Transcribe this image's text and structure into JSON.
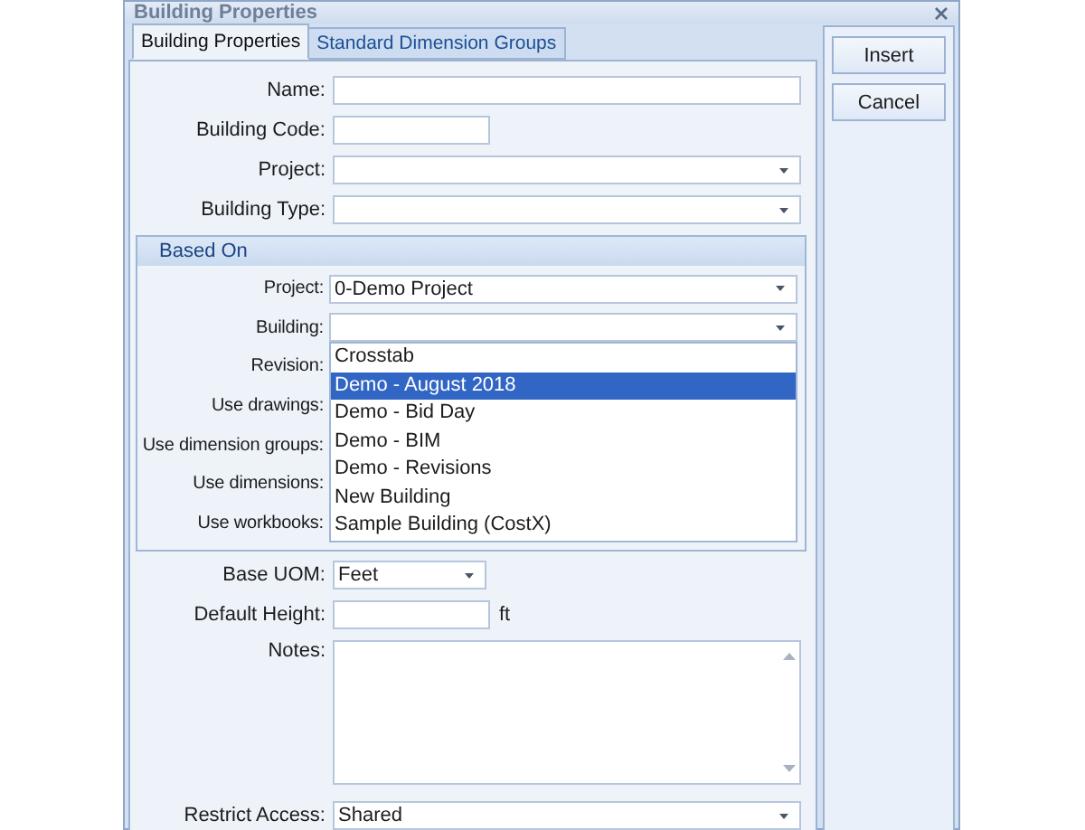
{
  "window": {
    "title": "Building Properties"
  },
  "tabs": [
    {
      "label": "Building Properties",
      "selected": true
    },
    {
      "label": "Standard Dimension Groups",
      "selected": false
    }
  ],
  "fields": [
    {
      "label": "Name:",
      "kind": "text"
    },
    {
      "label": "Building Code:",
      "kind": "short-text"
    },
    {
      "label": "Project:",
      "kind": "combo"
    },
    {
      "label": "Building Type:",
      "kind": "combo"
    }
  ],
  "based_on": {
    "title": "Based On",
    "fields": [
      {
        "label": "Project:",
        "kind": "combo",
        "value": "0-Demo Project"
      },
      {
        "label": "Building:",
        "kind": "combo",
        "expanded": true,
        "options": [
          {
            "label": "Crosstab",
            "selected": false
          },
          {
            "label": "Demo - August 2018",
            "selected": true
          },
          {
            "label": "Demo - Bid Day",
            "selected": false
          },
          {
            "label": "Demo - BIM",
            "selected": false
          },
          {
            "label": "Demo - Revisions",
            "selected": false
          },
          {
            "label": "New Building",
            "selected": false
          },
          {
            "label": "Sample Building (CostX)",
            "selected": false
          }
        ]
      },
      {
        "label": "Revision:"
      },
      {
        "label": "Use drawings:"
      },
      {
        "label": "Use dimension groups:"
      },
      {
        "label": "Use dimensions:"
      },
      {
        "label": "Use workbooks:"
      }
    ]
  },
  "fields_after": [
    {
      "label": "Base UOM:",
      "kind": "short-combo",
      "value": "Feet"
    },
    {
      "label": "Default Height:",
      "kind": "short-text",
      "suffix": "ft"
    },
    {
      "label": "Notes:",
      "kind": "memo"
    },
    {
      "label": "Restrict Access:",
      "kind": "combo",
      "value": "Shared"
    }
  ],
  "buttons": [
    {
      "label": "Insert"
    },
    {
      "label": "Cancel"
    }
  ]
}
